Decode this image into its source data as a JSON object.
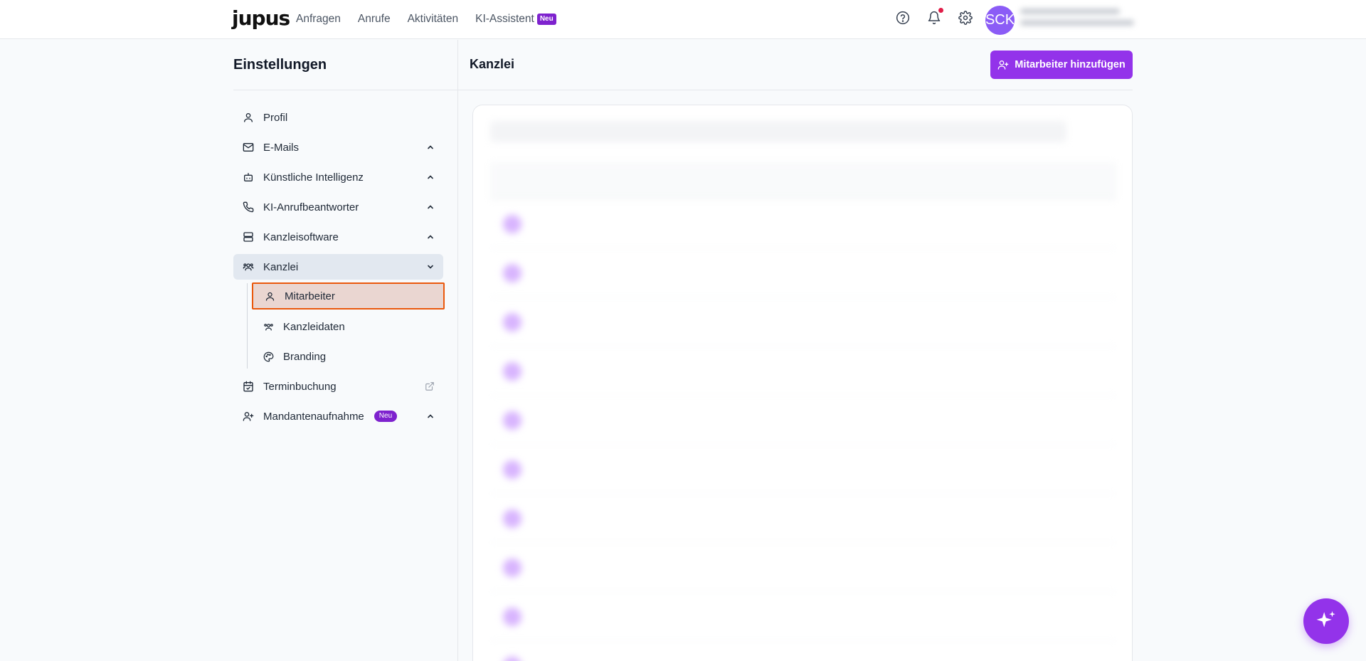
{
  "topnav": {
    "logo": "jupus",
    "links": [
      "Anfragen",
      "Anrufe",
      "Aktivitäten",
      "KI-Assistent"
    ],
    "ki_badge": "Neu",
    "avatar_initials": "SCK"
  },
  "sidebar": {
    "title": "Einstellungen",
    "items": [
      {
        "label": "Profil",
        "icon": "user-icon"
      },
      {
        "label": "E-Mails",
        "icon": "mail-icon"
      },
      {
        "label": "Künstliche Intelligenz",
        "icon": "bot-icon"
      },
      {
        "label": "KI-Anrufbeantworter",
        "icon": "phone-icon"
      },
      {
        "label": "Kanzleisoftware",
        "icon": "server-icon"
      },
      {
        "label": "Kanzlei",
        "icon": "users-icon"
      },
      {
        "label": "Terminbuchung",
        "icon": "calendar-check-icon"
      },
      {
        "label": "Mandantenaufnahme",
        "icon": "user-plus-icon",
        "badge": "Neu"
      }
    ],
    "subitems": [
      {
        "label": "Mitarbeiter",
        "icon": "user-icon"
      },
      {
        "label": "Kanzleidaten",
        "icon": "users-icon"
      },
      {
        "label": "Branding",
        "icon": "palette-icon"
      }
    ]
  },
  "main": {
    "title": "Kanzlei",
    "add_button": "Mitarbeiter hinzufügen"
  },
  "colors": {
    "accent": "#9333ea",
    "badge": "#7e22ce",
    "selected_border": "#ea580c",
    "selected_bg": "#ead6d1"
  }
}
